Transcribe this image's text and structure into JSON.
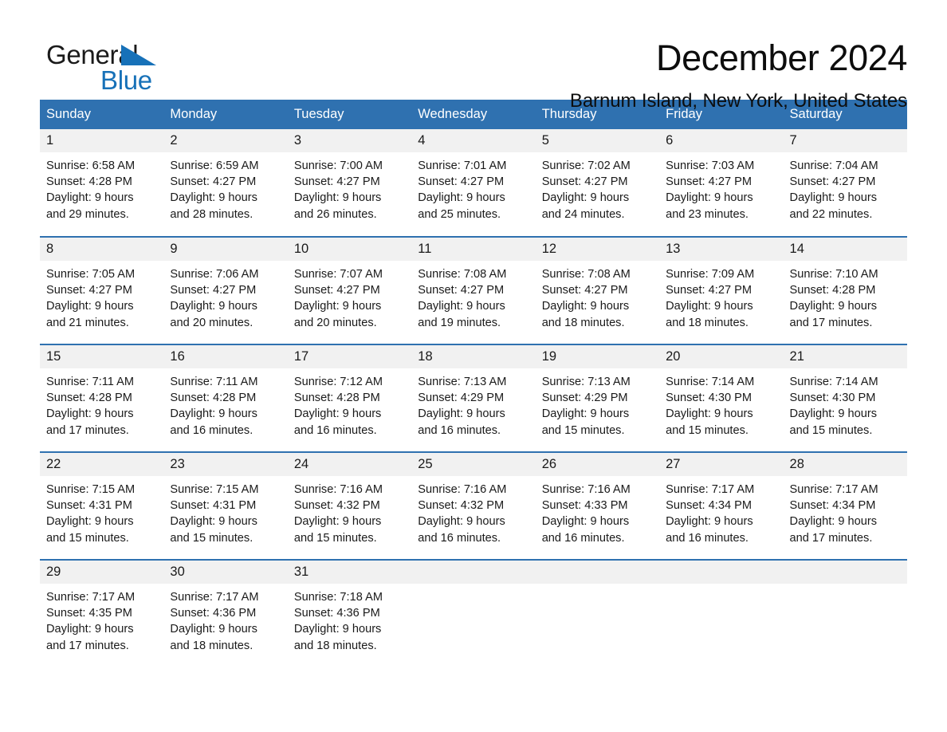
{
  "brand": {
    "line1": "General",
    "line2": "Blue",
    "triangle_icon": "brand-triangle-icon",
    "accent_color": "#1771b8"
  },
  "header": {
    "month_title": "December 2024",
    "location": "Barnum Island, New York, United States"
  },
  "theme": {
    "header_blue": "#2f71b0",
    "daynum_gray": "#f1f1f1",
    "text": "#1a1a1a"
  },
  "calendar": {
    "day_headers": [
      "Sunday",
      "Monday",
      "Tuesday",
      "Wednesday",
      "Thursday",
      "Friday",
      "Saturday"
    ],
    "weeks": [
      [
        {
          "day": "1",
          "sunrise": "Sunrise: 6:58 AM",
          "sunset": "Sunset: 4:28 PM",
          "daylight_line1": "Daylight: 9 hours",
          "daylight_line2": "and 29 minutes."
        },
        {
          "day": "2",
          "sunrise": "Sunrise: 6:59 AM",
          "sunset": "Sunset: 4:27 PM",
          "daylight_line1": "Daylight: 9 hours",
          "daylight_line2": "and 28 minutes."
        },
        {
          "day": "3",
          "sunrise": "Sunrise: 7:00 AM",
          "sunset": "Sunset: 4:27 PM",
          "daylight_line1": "Daylight: 9 hours",
          "daylight_line2": "and 26 minutes."
        },
        {
          "day": "4",
          "sunrise": "Sunrise: 7:01 AM",
          "sunset": "Sunset: 4:27 PM",
          "daylight_line1": "Daylight: 9 hours",
          "daylight_line2": "and 25 minutes."
        },
        {
          "day": "5",
          "sunrise": "Sunrise: 7:02 AM",
          "sunset": "Sunset: 4:27 PM",
          "daylight_line1": "Daylight: 9 hours",
          "daylight_line2": "and 24 minutes."
        },
        {
          "day": "6",
          "sunrise": "Sunrise: 7:03 AM",
          "sunset": "Sunset: 4:27 PM",
          "daylight_line1": "Daylight: 9 hours",
          "daylight_line2": "and 23 minutes."
        },
        {
          "day": "7",
          "sunrise": "Sunrise: 7:04 AM",
          "sunset": "Sunset: 4:27 PM",
          "daylight_line1": "Daylight: 9 hours",
          "daylight_line2": "and 22 minutes."
        }
      ],
      [
        {
          "day": "8",
          "sunrise": "Sunrise: 7:05 AM",
          "sunset": "Sunset: 4:27 PM",
          "daylight_line1": "Daylight: 9 hours",
          "daylight_line2": "and 21 minutes."
        },
        {
          "day": "9",
          "sunrise": "Sunrise: 7:06 AM",
          "sunset": "Sunset: 4:27 PM",
          "daylight_line1": "Daylight: 9 hours",
          "daylight_line2": "and 20 minutes."
        },
        {
          "day": "10",
          "sunrise": "Sunrise: 7:07 AM",
          "sunset": "Sunset: 4:27 PM",
          "daylight_line1": "Daylight: 9 hours",
          "daylight_line2": "and 20 minutes."
        },
        {
          "day": "11",
          "sunrise": "Sunrise: 7:08 AM",
          "sunset": "Sunset: 4:27 PM",
          "daylight_line1": "Daylight: 9 hours",
          "daylight_line2": "and 19 minutes."
        },
        {
          "day": "12",
          "sunrise": "Sunrise: 7:08 AM",
          "sunset": "Sunset: 4:27 PM",
          "daylight_line1": "Daylight: 9 hours",
          "daylight_line2": "and 18 minutes."
        },
        {
          "day": "13",
          "sunrise": "Sunrise: 7:09 AM",
          "sunset": "Sunset: 4:27 PM",
          "daylight_line1": "Daylight: 9 hours",
          "daylight_line2": "and 18 minutes."
        },
        {
          "day": "14",
          "sunrise": "Sunrise: 7:10 AM",
          "sunset": "Sunset: 4:28 PM",
          "daylight_line1": "Daylight: 9 hours",
          "daylight_line2": "and 17 minutes."
        }
      ],
      [
        {
          "day": "15",
          "sunrise": "Sunrise: 7:11 AM",
          "sunset": "Sunset: 4:28 PM",
          "daylight_line1": "Daylight: 9 hours",
          "daylight_line2": "and 17 minutes."
        },
        {
          "day": "16",
          "sunrise": "Sunrise: 7:11 AM",
          "sunset": "Sunset: 4:28 PM",
          "daylight_line1": "Daylight: 9 hours",
          "daylight_line2": "and 16 minutes."
        },
        {
          "day": "17",
          "sunrise": "Sunrise: 7:12 AM",
          "sunset": "Sunset: 4:28 PM",
          "daylight_line1": "Daylight: 9 hours",
          "daylight_line2": "and 16 minutes."
        },
        {
          "day": "18",
          "sunrise": "Sunrise: 7:13 AM",
          "sunset": "Sunset: 4:29 PM",
          "daylight_line1": "Daylight: 9 hours",
          "daylight_line2": "and 16 minutes."
        },
        {
          "day": "19",
          "sunrise": "Sunrise: 7:13 AM",
          "sunset": "Sunset: 4:29 PM",
          "daylight_line1": "Daylight: 9 hours",
          "daylight_line2": "and 15 minutes."
        },
        {
          "day": "20",
          "sunrise": "Sunrise: 7:14 AM",
          "sunset": "Sunset: 4:30 PM",
          "daylight_line1": "Daylight: 9 hours",
          "daylight_line2": "and 15 minutes."
        },
        {
          "day": "21",
          "sunrise": "Sunrise: 7:14 AM",
          "sunset": "Sunset: 4:30 PM",
          "daylight_line1": "Daylight: 9 hours",
          "daylight_line2": "and 15 minutes."
        }
      ],
      [
        {
          "day": "22",
          "sunrise": "Sunrise: 7:15 AM",
          "sunset": "Sunset: 4:31 PM",
          "daylight_line1": "Daylight: 9 hours",
          "daylight_line2": "and 15 minutes."
        },
        {
          "day": "23",
          "sunrise": "Sunrise: 7:15 AM",
          "sunset": "Sunset: 4:31 PM",
          "daylight_line1": "Daylight: 9 hours",
          "daylight_line2": "and 15 minutes."
        },
        {
          "day": "24",
          "sunrise": "Sunrise: 7:16 AM",
          "sunset": "Sunset: 4:32 PM",
          "daylight_line1": "Daylight: 9 hours",
          "daylight_line2": "and 15 minutes."
        },
        {
          "day": "25",
          "sunrise": "Sunrise: 7:16 AM",
          "sunset": "Sunset: 4:32 PM",
          "daylight_line1": "Daylight: 9 hours",
          "daylight_line2": "and 16 minutes."
        },
        {
          "day": "26",
          "sunrise": "Sunrise: 7:16 AM",
          "sunset": "Sunset: 4:33 PM",
          "daylight_line1": "Daylight: 9 hours",
          "daylight_line2": "and 16 minutes."
        },
        {
          "day": "27",
          "sunrise": "Sunrise: 7:17 AM",
          "sunset": "Sunset: 4:34 PM",
          "daylight_line1": "Daylight: 9 hours",
          "daylight_line2": "and 16 minutes."
        },
        {
          "day": "28",
          "sunrise": "Sunrise: 7:17 AM",
          "sunset": "Sunset: 4:34 PM",
          "daylight_line1": "Daylight: 9 hours",
          "daylight_line2": "and 17 minutes."
        }
      ],
      [
        {
          "day": "29",
          "sunrise": "Sunrise: 7:17 AM",
          "sunset": "Sunset: 4:35 PM",
          "daylight_line1": "Daylight: 9 hours",
          "daylight_line2": "and 17 minutes."
        },
        {
          "day": "30",
          "sunrise": "Sunrise: 7:17 AM",
          "sunset": "Sunset: 4:36 PM",
          "daylight_line1": "Daylight: 9 hours",
          "daylight_line2": "and 18 minutes."
        },
        {
          "day": "31",
          "sunrise": "Sunrise: 7:18 AM",
          "sunset": "Sunset: 4:36 PM",
          "daylight_line1": "Daylight: 9 hours",
          "daylight_line2": "and 18 minutes."
        },
        {
          "day": "",
          "sunrise": "",
          "sunset": "",
          "daylight_line1": "",
          "daylight_line2": ""
        },
        {
          "day": "",
          "sunrise": "",
          "sunset": "",
          "daylight_line1": "",
          "daylight_line2": ""
        },
        {
          "day": "",
          "sunrise": "",
          "sunset": "",
          "daylight_line1": "",
          "daylight_line2": ""
        },
        {
          "day": "",
          "sunrise": "",
          "sunset": "",
          "daylight_line1": "",
          "daylight_line2": ""
        }
      ]
    ]
  }
}
